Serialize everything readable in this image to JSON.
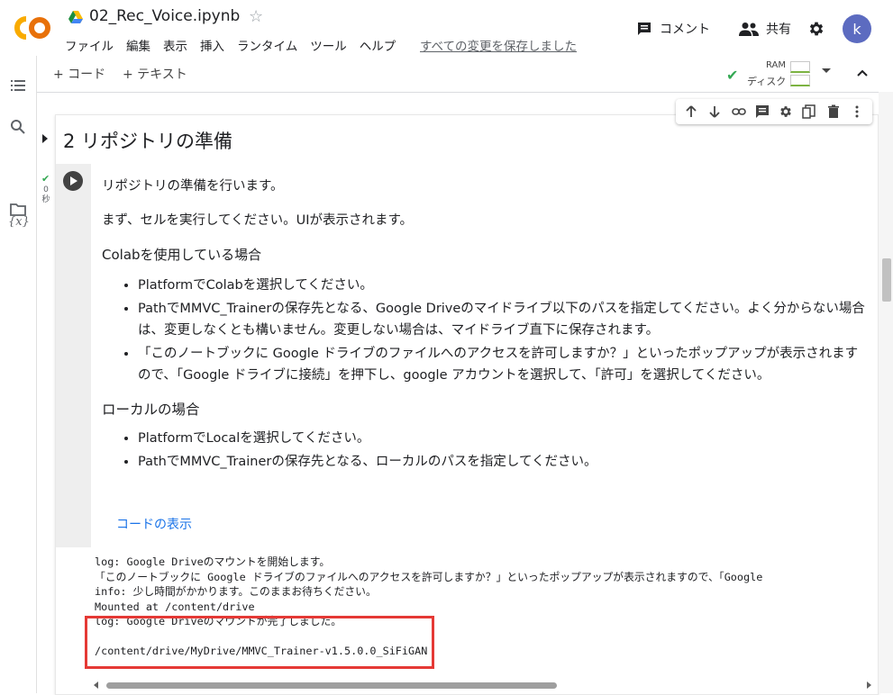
{
  "app": {
    "logo_text": "CO",
    "notebook_title": "02_Rec_Voice.ipynb",
    "menu": [
      "ファイル",
      "編集",
      "表示",
      "挿入",
      "ランタイム",
      "ツール",
      "ヘルプ"
    ],
    "saved_status": "すべての変更を保存しました",
    "comment_label": "コメント",
    "share_label": "共有",
    "avatar_letter": "k"
  },
  "toolbar": {
    "add_code": "+ コード",
    "add_text": "+ テキスト",
    "ram_label": "RAM",
    "disk_label": "ディスク"
  },
  "cell_toolbar_icons": [
    "arrow-up-icon",
    "arrow-down-icon",
    "link-icon",
    "comment-icon",
    "gear-icon",
    "mirror-cell-icon",
    "delete-icon",
    "more-vert-icon"
  ],
  "section": {
    "heading": "2 リポジトリの準備"
  },
  "cell": {
    "exec_time_value": "0",
    "exec_time_unit": "秒",
    "intro": "リポジトリの準備を行います。",
    "instruction": "まず、セルを実行してください。UIが表示されます。",
    "colab_heading": "Colabを使用している場合",
    "colab_items": [
      "PlatformでColabを選択してください。",
      "PathでMMVC_Trainerの保存先となる、Google Driveのマイドライブ以下のパスを指定してください。よく分からない場合は、変更しなくとも構いません。変更しない場合は、マイドライブ直下に保存されます。",
      "「このノートブックに Google ドライブのファイルへのアクセスを許可しますか？」といったポップアップが表示されますので、「Google ドライブに接続」を押下し、google アカウントを選択して、「許可」を選択してください。"
    ],
    "local_heading": "ローカルの場合",
    "local_items": [
      "PlatformでLocalを選択してください。",
      "PathでMMVC_Trainerの保存先となる、ローカルのパスを指定してください。"
    ],
    "show_code": "コードの表示"
  },
  "output": {
    "lines": [
      "log: Google Driveのマウントを開始します。",
      "「このノートブックに Google ドライブのファイルへのアクセスを許可しますか？」といったポップアップが表示されますので、「Google",
      "info: 少し時間がかかります。このままお待ちください。",
      "Mounted at /content/drive",
      "log: Google Driveのマウントが完了しました。",
      "",
      "/content/drive/MyDrive/MMVC_Trainer-v1.5.0.0_SiFiGAN"
    ]
  },
  "colors": {
    "accent_check": "#34a853",
    "highlight_border": "#e53935",
    "link": "#1a73e8",
    "logo_orange": "#f9ab00",
    "logo_orange_dark": "#e8710a"
  }
}
